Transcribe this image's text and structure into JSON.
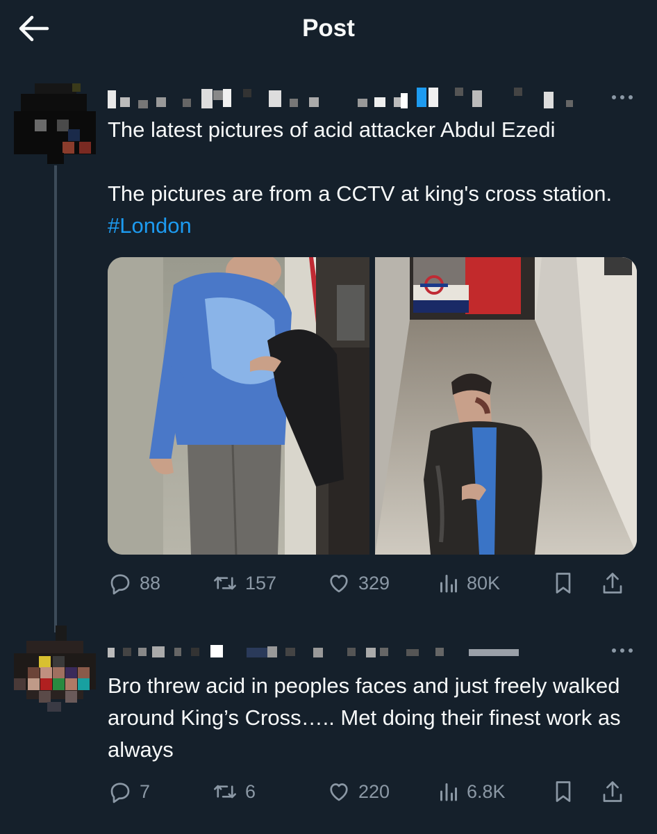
{
  "header": {
    "title": "Post"
  },
  "post": {
    "text": "The latest pictures of acid attacker Abdul Ezedi\n\nThe pictures are from a CCTV at king's cross station. ",
    "hashtag": "#London",
    "stats": {
      "replies": "88",
      "reposts": "157",
      "likes": "329",
      "views": "80K"
    }
  },
  "reply": {
    "text": "Bro threw acid in peoples faces and just freely walked around King’s Cross….. Met doing their finest work as always",
    "stats": {
      "replies": "7",
      "reposts": "6",
      "likes": "220",
      "views": "6.8K"
    }
  },
  "icons": {
    "back": "arrow-left-icon",
    "more": "more-horizontal-icon",
    "reply": "reply-bubble-icon",
    "repost": "repost-icon",
    "like": "heart-icon",
    "views": "views-bar-icon",
    "bookmark": "bookmark-icon",
    "share": "share-icon"
  },
  "colors": {
    "background": "#15202b",
    "text": "#f7f9f9",
    "secondary": "#8b98a5",
    "accent": "#1d9bf0",
    "thread_line": "#3d4b59"
  }
}
